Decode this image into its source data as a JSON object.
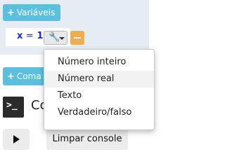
{
  "variables_panel": {
    "add_button_label": "Variáveis",
    "add_button_icon": "plus-icon",
    "variable": {
      "name": "x",
      "equals": "=",
      "value": "1"
    },
    "type_button_icon": "wrench-icon",
    "remove_button_icon": "minus-icon"
  },
  "commands": {
    "add_button_label": "Coma"
  },
  "console": {
    "icon_text": ">_",
    "title": "Co",
    "run_button_icon": "play-icon",
    "clear_button_label": "Limpar console"
  },
  "type_dropdown": {
    "items": [
      {
        "label": "Número inteiro"
      },
      {
        "label": "Número real"
      },
      {
        "label": "Texto"
      },
      {
        "label": "Verdadeiro/falso"
      }
    ],
    "highlighted_index": 1
  },
  "colors": {
    "accent_blue": "#5bc0de",
    "variable_blue": "#1a2ad8",
    "remove_orange": "#f0ad4e",
    "panel_bg": "#e7edf5"
  }
}
